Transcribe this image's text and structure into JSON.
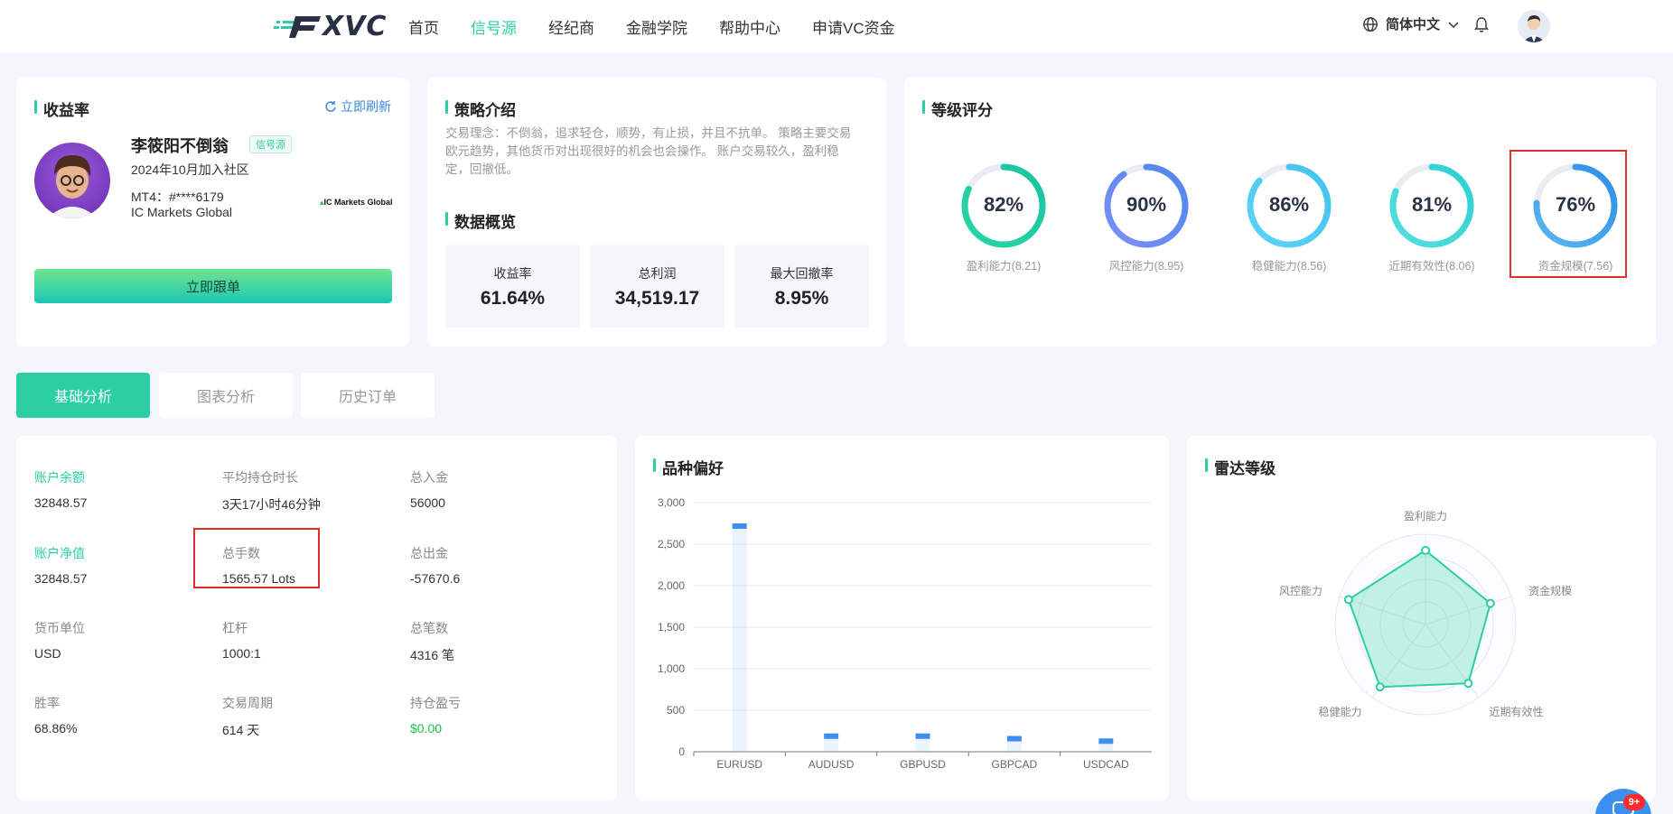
{
  "header": {
    "logo_text": "XVC",
    "nav": [
      "首页",
      "信号源",
      "经纪商",
      "金融学院",
      "帮助中心",
      "申请VC资金"
    ],
    "active_nav": 1,
    "language": "简体中文"
  },
  "profile": {
    "title": "收益率",
    "refresh": "立即刷新",
    "name": "李筱阳不倒翁",
    "tag": "信号源",
    "joined": "2024年10月加入社区",
    "mt4": "MT4：#****6179",
    "broker": "IC Markets Global",
    "broker_logo": "IC Markets Global",
    "follow_button": "立即跟单"
  },
  "strategy": {
    "title": "策略介绍",
    "text": "交易理念：不倒翁，追求轻仓，顺势，有止损，并且不抗单。 策略主要交易欧元趋势，其他货币对出现很好的机会也会操作。 账户交易较久，盈利稳定，回撤低。",
    "overview_title": "数据概览",
    "stats": [
      {
        "label": "收益率",
        "value": "61.64%"
      },
      {
        "label": "总利润",
        "value": "34,519.17"
      },
      {
        "label": "最大回撤率",
        "value": "8.95%"
      }
    ]
  },
  "rating": {
    "title": "等级评分",
    "items": [
      {
        "pct": "82%",
        "value": 82,
        "label": "盈利能力(8.21)",
        "color_from": "#2ad5a2",
        "color_to": "#19c4a4"
      },
      {
        "pct": "90%",
        "value": 90,
        "label": "风控能力(8.95)",
        "color_from": "#7b8ff6",
        "color_to": "#4f86f0"
      },
      {
        "pct": "86%",
        "value": 86,
        "label": "稳健能力(8.56)",
        "color_from": "#5fd3f7",
        "color_to": "#40c2ef"
      },
      {
        "pct": "81%",
        "value": 81,
        "label": "近期有效性(8.06)",
        "color_from": "#53dfe0",
        "color_to": "#2fcfd2"
      },
      {
        "pct": "76%",
        "value": 76,
        "label": "资金规模(7.56)",
        "color_from": "#5ab7f0",
        "color_to": "#2e8ee6"
      }
    ]
  },
  "tabs": [
    "基础分析",
    "图表分析",
    "历史订单"
  ],
  "account": {
    "rows": [
      [
        {
          "label": "账户余额",
          "value": "32848.57",
          "green_label": true
        },
        {
          "label": "平均持仓时长",
          "value": "3天17小时46分钟"
        },
        {
          "label": "总入金",
          "value": "56000"
        }
      ],
      [
        {
          "label": "账户净值",
          "value": "32848.57",
          "green_label": true
        },
        {
          "label": "总手数",
          "value": "1565.57 Lots"
        },
        {
          "label": "总出金",
          "value": "-57670.6"
        }
      ],
      [
        {
          "label": "货币单位",
          "value": "USD"
        },
        {
          "label": "杠杆",
          "value": "1000:1"
        },
        {
          "label": "总笔数",
          "value": "4316 笔"
        }
      ],
      [
        {
          "label": "胜率",
          "value": "68.86%"
        },
        {
          "label": "交易周期",
          "value": "614 天"
        },
        {
          "label": "持仓盈亏",
          "value": "$0.00",
          "green_value": true
        }
      ]
    ]
  },
  "variety": {
    "title": "品种偏好"
  },
  "radar": {
    "title": "雷达等级",
    "labels": [
      "盈利能力",
      "资金规模",
      "近期有效性",
      "稳健能力",
      "风控能力"
    ],
    "values": [
      8.21,
      7.56,
      8.06,
      8.56,
      8.95
    ]
  },
  "chart_data": {
    "type": "bar",
    "categories": [
      "EURUSD",
      "AUDUSD",
      "GBPUSD",
      "GBPCAD",
      "USDCAD"
    ],
    "values": [
      2750,
      220,
      220,
      190,
      160
    ],
    "ylim": [
      0,
      3000
    ],
    "yticks": [
      "0",
      "500",
      "1,000",
      "1,500",
      "2,000",
      "2,500",
      "3,000"
    ],
    "grid": true,
    "bar_color": "#3d8ef0"
  },
  "badge": "9+"
}
